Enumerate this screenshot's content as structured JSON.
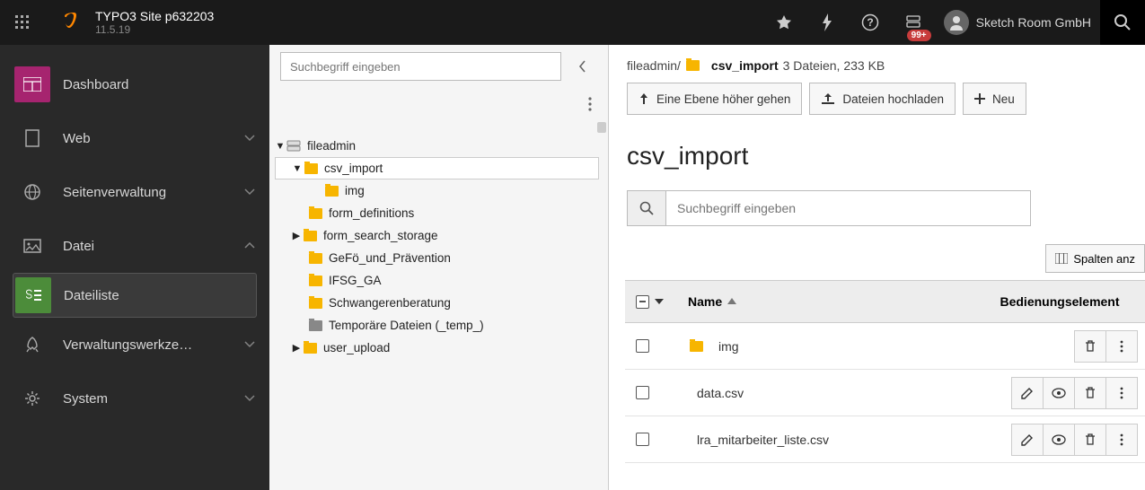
{
  "topbar": {
    "site_title": "TYPO3 Site p632203",
    "version": "11.5.19",
    "notification_count": "99+",
    "user_name": "Sketch Room GmbH"
  },
  "nav": {
    "items": [
      {
        "label": "Dashboard",
        "active": true
      },
      {
        "label": "Web",
        "chev": true
      },
      {
        "label": "Seitenverwaltung",
        "chev": true
      },
      {
        "label": "Datei",
        "chev": true,
        "open": true
      },
      {
        "label": "Dateiliste",
        "sub": true,
        "active": true
      },
      {
        "label": "Verwaltungswerkze…",
        "chev": true
      },
      {
        "label": "System",
        "chev": true
      }
    ]
  },
  "tree": {
    "search_placeholder": "Suchbegriff eingeben",
    "root": "fileadmin",
    "nodes": [
      {
        "depth": 0,
        "label": "fileadmin",
        "expanded": true,
        "root": true
      },
      {
        "depth": 1,
        "label": "csv_import",
        "expanded": true,
        "selected": true
      },
      {
        "depth": 2,
        "label": "img"
      },
      {
        "depth": 1,
        "label": "form_definitions"
      },
      {
        "depth": 1,
        "label": "form_search_storage",
        "expandable": true
      },
      {
        "depth": 1,
        "label": "GeFö_und_Prävention"
      },
      {
        "depth": 1,
        "label": "IFSG_GA"
      },
      {
        "depth": 1,
        "label": "Schwangerenberatung"
      },
      {
        "depth": 1,
        "label": "Temporäre Dateien (_temp_)",
        "gray": true
      },
      {
        "depth": 1,
        "label": "user_upload",
        "expandable": true
      }
    ]
  },
  "content": {
    "breadcrumb": {
      "root": "fileadmin/",
      "current": "csv_import",
      "summary": "3 Dateien, 233 KB"
    },
    "toolbar": {
      "up": "Eine Ebene höher gehen",
      "upload": "Dateien hochladen",
      "new": "Neu"
    },
    "title": "csv_import",
    "search_placeholder": "Suchbegriff eingeben",
    "columns_btn": "Spalten anz",
    "table": {
      "col_name": "Name",
      "col_ops": "Bedienungselement",
      "rows": [
        {
          "type": "folder",
          "name": "img"
        },
        {
          "type": "csv",
          "name": "data.csv"
        },
        {
          "type": "csv",
          "name": "lra_mitarbeiter_liste.csv"
        }
      ]
    }
  }
}
